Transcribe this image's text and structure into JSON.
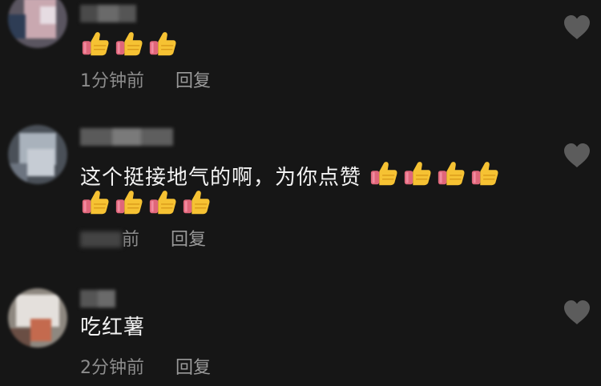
{
  "comments": [
    {
      "text": "",
      "time": "1分钟前",
      "reply_label": "回复",
      "thumbs_count": 3
    },
    {
      "text": "这个挺接地气的啊，为你点赞",
      "time": "前",
      "reply_label": "回复",
      "thumbs_inline": 4,
      "thumbs_second_line": 4
    },
    {
      "text": "吃红薯",
      "time": "2分钟前",
      "reply_label": "回复"
    }
  ],
  "icons": {
    "like": "heart-icon",
    "emoji": "thumbs-up-emoji"
  },
  "colors": {
    "background": "#161616",
    "heart": "#5c5c5c",
    "meta_text": "#8c8c8c"
  }
}
